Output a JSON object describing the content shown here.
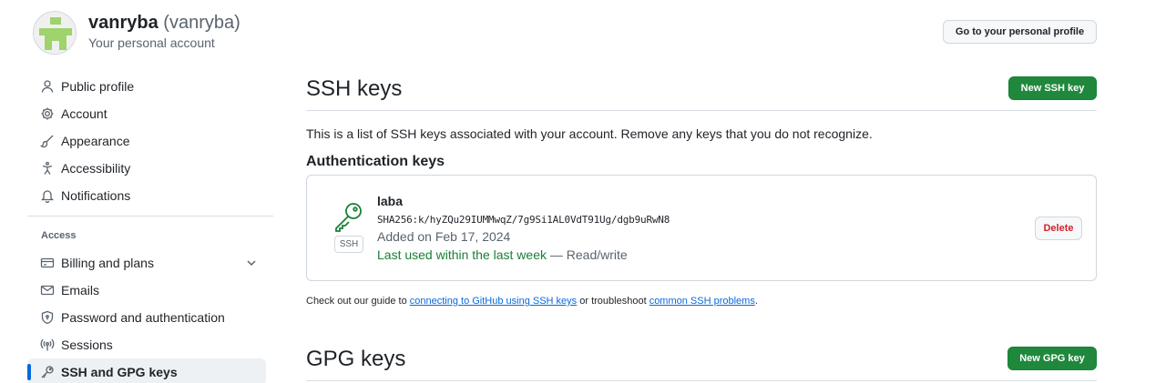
{
  "header": {
    "display_name": "vanryba",
    "login": "(vanryba)",
    "subtitle": "Your personal account",
    "profile_button": "Go to your personal profile"
  },
  "sidebar": {
    "items": [
      {
        "label": "Public profile",
        "icon": "person-icon"
      },
      {
        "label": "Account",
        "icon": "gear-icon"
      },
      {
        "label": "Appearance",
        "icon": "paintbrush-icon"
      },
      {
        "label": "Accessibility",
        "icon": "accessibility-icon"
      },
      {
        "label": "Notifications",
        "icon": "bell-icon"
      }
    ],
    "access_heading": "Access",
    "access_items": [
      {
        "label": "Billing and plans",
        "icon": "credit-card-icon"
      },
      {
        "label": "Emails",
        "icon": "mail-icon"
      },
      {
        "label": "Password and authentication",
        "icon": "shield-lock-icon"
      },
      {
        "label": "Sessions",
        "icon": "broadcast-icon"
      },
      {
        "label": "SSH and GPG keys",
        "icon": "key-icon",
        "active": true
      }
    ]
  },
  "ssh": {
    "title": "SSH keys",
    "new_button": "New SSH key",
    "description": "This is a list of SSH keys associated with your account. Remove any keys that you do not recognize.",
    "auth_heading": "Authentication keys",
    "keys": [
      {
        "title": "laba",
        "fingerprint": "SHA256:k/hyZQu29IUMMwqZ/7g9Si1AL0VdT91Ug/dgb9uRwN8",
        "added": "Added on Feb 17, 2024",
        "last_used": "Last used within the last week",
        "access": " — Read/write",
        "badge": "SSH",
        "delete_label": "Delete"
      }
    ],
    "guide_prefix": "Check out our guide to ",
    "guide_link1": "connecting to GitHub using SSH keys",
    "guide_middle": " or troubleshoot ",
    "guide_link2": "common SSH problems",
    "guide_suffix": "."
  },
  "gpg": {
    "title": "GPG keys",
    "new_button": "New GPG key"
  },
  "colors": {
    "primary_button": "#1f883d",
    "accent": "#0969da",
    "danger": "#d1242f",
    "success_text": "#1a7f37"
  }
}
